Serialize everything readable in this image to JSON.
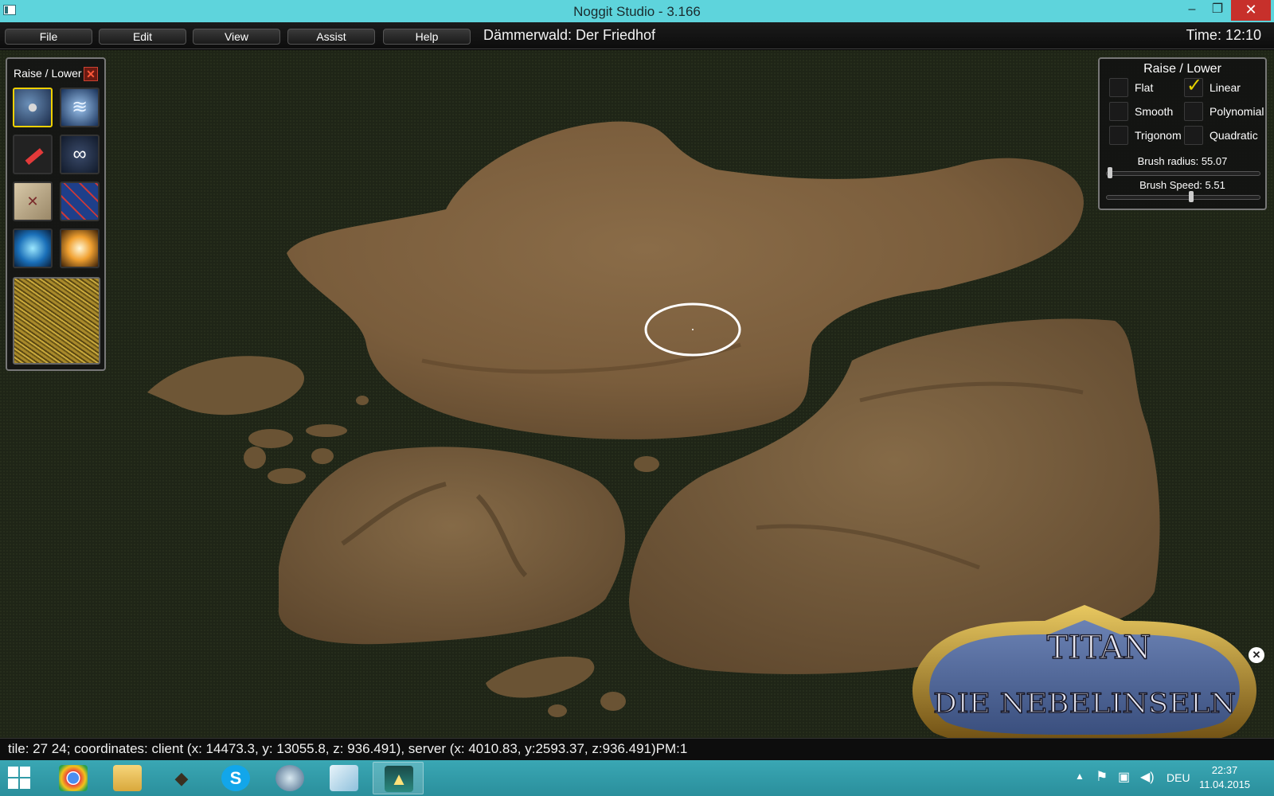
{
  "window": {
    "title": "Noggit Studio - 3.166",
    "controls": {
      "minimize": "–",
      "maximize": "❐",
      "close": "✕"
    }
  },
  "menu": {
    "items": [
      {
        "label": "File"
      },
      {
        "label": "Edit"
      },
      {
        "label": "View"
      },
      {
        "label": "Assist"
      },
      {
        "label": "Help"
      }
    ],
    "map_title": "Dämmerwald: Der Friedhof",
    "time": "Time: 12:10"
  },
  "tool_panel": {
    "title": "Raise / Lower",
    "close_glyph": "✕",
    "tools": [
      {
        "icon": "rock-raise-lower-icon",
        "selected": true
      },
      {
        "icon": "flatten-blur-icon",
        "selected": false
      },
      {
        "icon": "paint-brush-icon",
        "selected": false
      },
      {
        "icon": "holes-rings-icon",
        "selected": false
      },
      {
        "icon": "map-chunk-icon",
        "selected": false
      },
      {
        "icon": "area-id-grid-icon",
        "selected": false
      },
      {
        "icon": "water-orb-icon",
        "selected": false
      },
      {
        "icon": "light-flare-icon",
        "selected": false
      }
    ],
    "texture": "grass-texture-swatch"
  },
  "brush_panel": {
    "title": "Raise / Lower",
    "options": [
      {
        "label": "Flat",
        "checked": false
      },
      {
        "label": "Linear",
        "checked": true
      },
      {
        "label": "Smooth",
        "checked": false
      },
      {
        "label": "Polynomial",
        "checked": false
      },
      {
        "label": "Trigonom",
        "checked": false
      },
      {
        "label": "Quadratic",
        "checked": false
      }
    ],
    "radius": {
      "label": "Brush radius: 55.07",
      "fraction": 0.02
    },
    "speed": {
      "label": "Brush Speed: 5.51",
      "fraction": 0.55
    }
  },
  "logo": {
    "line1": "TITAN",
    "line2": "DIE NEBELINSELN",
    "close_glyph": "✕"
  },
  "status": {
    "text": "tile: 27 24; coordinates: client (x: 14473.3, y: 13055.8, z: 936.491), server (x: 4010.83, y:2593.37, z:936.491)PM:1"
  },
  "taskbar": {
    "apps": [
      {
        "icon": "chrome-icon",
        "active": false
      },
      {
        "icon": "file-explorer-icon",
        "active": false
      },
      {
        "icon": "gimp-icon",
        "active": false
      },
      {
        "icon": "skype-icon",
        "active": false
      },
      {
        "icon": "steam-icon",
        "active": false
      },
      {
        "icon": "notepad-icon",
        "active": false
      },
      {
        "icon": "noggit-icon",
        "active": true
      }
    ],
    "language": "DEU",
    "time": "22:37",
    "date": "11.04.2015"
  },
  "colors": {
    "terrain": "#7a5e3e",
    "background": "#202617",
    "titlebar": "#5ed4dc",
    "accent_check": "#e4d200"
  }
}
